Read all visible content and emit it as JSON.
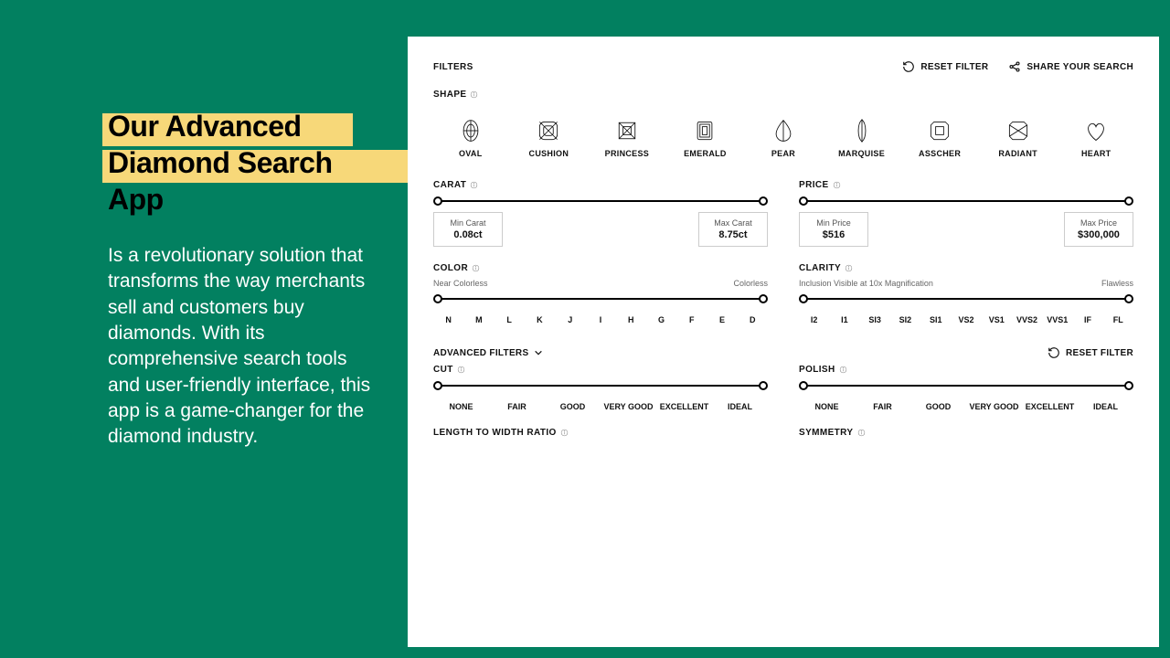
{
  "marketing": {
    "headline_line1": "Our Advanced",
    "headline_line2": "Diamond Search App",
    "subcopy": "Is a revolutionary solution that transforms the way merchants sell and customers buy diamonds. With its comprehensive search tools and user-friendly interface, this app is a game-changer for the diamond industry."
  },
  "panel": {
    "title": "FILTERS",
    "reset_label": "RESET FILTER",
    "share_label": "SHARE YOUR SEARCH",
    "shape": {
      "title": "SHAPE",
      "items": [
        "OVAL",
        "CUSHION",
        "PRINCESS",
        "EMERALD",
        "PEAR",
        "MARQUISE",
        "ASSCHER",
        "RADIANT",
        "HEART"
      ]
    },
    "carat": {
      "title": "CARAT",
      "min_label": "Min Carat",
      "min_value": "0.08ct",
      "max_label": "Max Carat",
      "max_value": "8.75ct"
    },
    "price": {
      "title": "PRICE",
      "min_label": "Min Price",
      "min_value": "$516",
      "max_label": "Max Price",
      "max_value": "$300,000"
    },
    "color": {
      "title": "COLOR",
      "left_hint": "Near Colorless",
      "right_hint": "Colorless",
      "ticks": [
        "N",
        "M",
        "L",
        "K",
        "J",
        "I",
        "H",
        "G",
        "F",
        "E",
        "D"
      ]
    },
    "clarity": {
      "title": "CLARITY",
      "left_hint": "Inclusion Visible at 10x Magnification",
      "right_hint": "Flawless",
      "ticks": [
        "I2",
        "I1",
        "SI3",
        "SI2",
        "SI1",
        "VS2",
        "VS1",
        "VVS2",
        "VVS1",
        "IF",
        "FL"
      ]
    },
    "advanced": {
      "toggle_label": "ADVANCED FILTERS",
      "reset_label": "RESET FILTER"
    },
    "cut": {
      "title": "CUT",
      "ticks": [
        "NONE",
        "FAIR",
        "GOOD",
        "VERY GOOD",
        "EXCELLENT",
        "IDEAL"
      ]
    },
    "polish": {
      "title": "POLISH",
      "ticks": [
        "NONE",
        "FAIR",
        "GOOD",
        "VERY GOOD",
        "EXCELLENT",
        "IDEAL"
      ]
    },
    "ratio": {
      "title": "LENGTH TO WIDTH RATIO"
    },
    "symmetry": {
      "title": "SYMMETRY"
    }
  }
}
